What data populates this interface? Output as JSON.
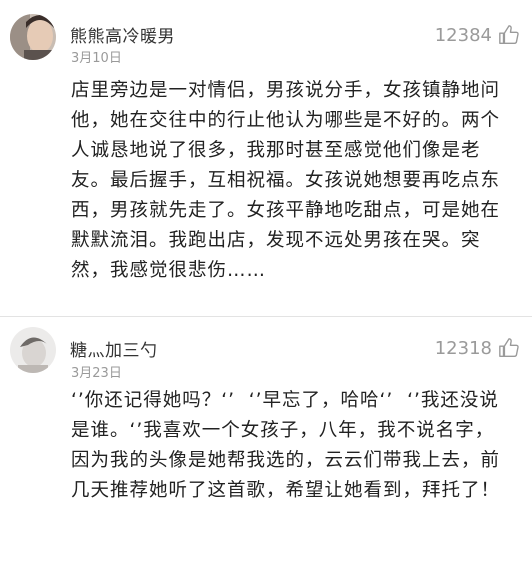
{
  "comments": [
    {
      "username": "熊熊高冷暖男",
      "date": "3月10日",
      "likes": "12384",
      "text": "店里旁边是一对情侣，男孩说分手，女孩镇静地问他，她在交往中的行止他认为哪些是不好的。两个人诚恳地说了很多，我那时甚至感觉他们像是老友。最后握手，互相祝福。女孩说她想要再吃点东西，男孩就先走了。女孩平静地吃甜点，可是她在默默流泪。我跑出店，发现不远处男孩在哭。突然，我感觉很悲伤……",
      "icons": {
        "avatar": "avatar-photo",
        "like": "thumbs-up-icon"
      }
    },
    {
      "username": "糖灬加三勺",
      "date": "3月23日",
      "likes": "12318",
      "text": "‘’你还记得她吗？‘’  ‘’早忘了，哈哈‘’  ‘’我还没说是谁。‘’我喜欢一个女孩子，八年，我不说名字，因为我的头像是她帮我选的，云云们带我上去，前几天推荐她听了这首歌，希望让她看到，拜托了！",
      "icons": {
        "avatar": "avatar-photo",
        "like": "thumbs-up-icon"
      }
    }
  ],
  "colors": {
    "username": "#333333",
    "meta": "#9a9a9a",
    "text": "#222222",
    "divider": "#e3e3e3"
  }
}
